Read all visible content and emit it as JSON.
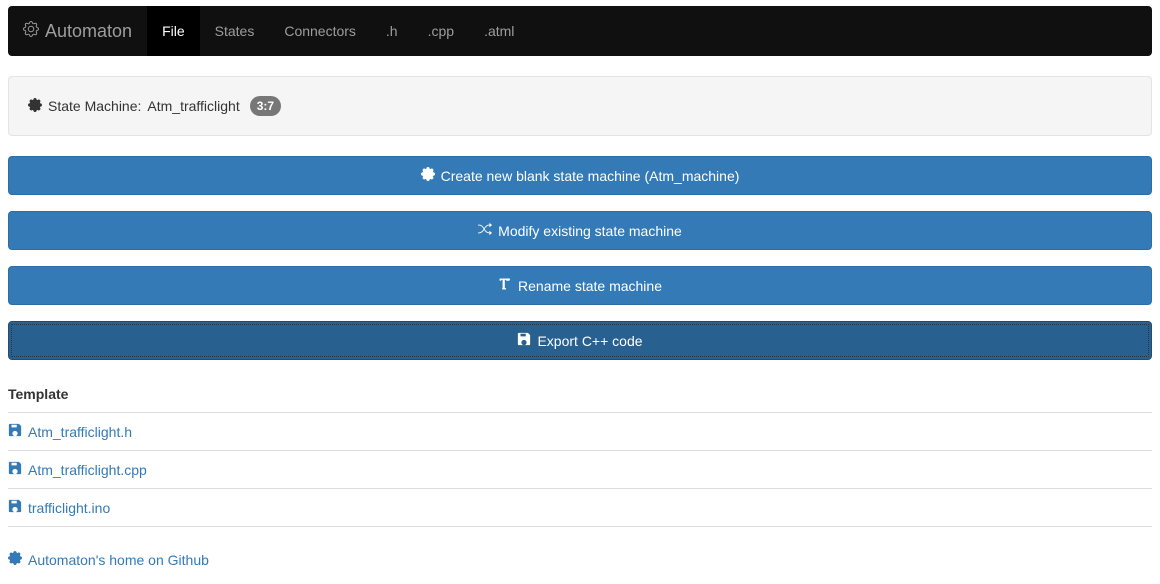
{
  "navbar": {
    "brand": "Automaton",
    "items": [
      {
        "label": "File",
        "active": true
      },
      {
        "label": "States",
        "active": false
      },
      {
        "label": "Connectors",
        "active": false
      },
      {
        "label": ".h",
        "active": false
      },
      {
        "label": ".cpp",
        "active": false
      },
      {
        "label": ".atml",
        "active": false
      }
    ]
  },
  "well": {
    "prefix": "State Machine:",
    "name": "Atm_trafficlight",
    "badge": "3:7"
  },
  "buttons": {
    "create": "Create new blank state machine (Atm_machine)",
    "modify": "Modify existing state machine",
    "rename": "Rename state machine",
    "export": "Export C++ code"
  },
  "templates": {
    "header": "Template",
    "items": [
      "Atm_trafficlight.h",
      "Atm_trafficlight.cpp",
      "trafficlight.ino"
    ]
  },
  "footer": {
    "github": "Automaton's home on Github"
  }
}
